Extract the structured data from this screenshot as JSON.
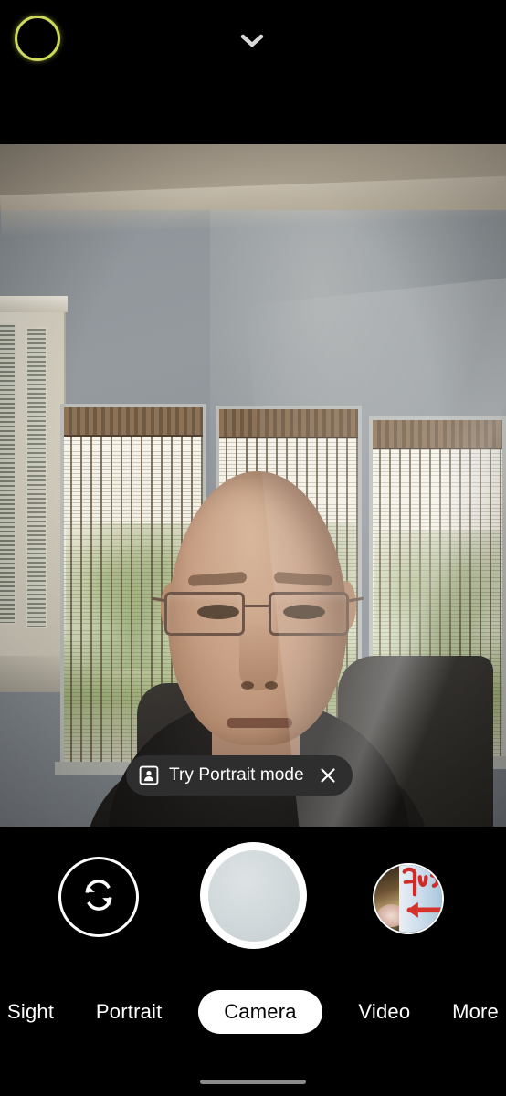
{
  "app": {
    "name": "Camera",
    "screen": "viewfinder"
  },
  "top_bar": {
    "recording_indicator_name": "camera-active-indicator",
    "recording_indicator_color": "#cdd95a",
    "expand_label": "chevron-down-icon"
  },
  "viewfinder": {
    "description": "Front-facing camera selfie preview of a bald man wearing glasses in a room with blue-gray walls and three windows with vertical blinds",
    "scene": {
      "ceiling_color": "#a79d8c",
      "wall_color": "#8e9499",
      "subject": "person",
      "windows": 3,
      "cabinet_color": "#e6e1d4",
      "shirt_color": "#1d1b1a"
    }
  },
  "suggestion": {
    "icon": "portrait-frame-icon",
    "text": "Try Portrait mode",
    "close_icon": "close-icon",
    "background_color": "#2e2e2e"
  },
  "controls": {
    "flip_camera_label": "flip-camera-icon",
    "shutter_label": "shutter-button",
    "shutter_fill_color": "#ccd4d6",
    "gallery_label": "gallery-thumbnail",
    "gallery_preview": "photo with red handwriting and a red arrow on a light blue panel"
  },
  "modes": {
    "items": [
      {
        "label": "Sight",
        "active": false,
        "truncated": true
      },
      {
        "label": "Portrait",
        "active": false,
        "truncated": false
      },
      {
        "label": "Camera",
        "active": true,
        "truncated": false
      },
      {
        "label": "Video",
        "active": false,
        "truncated": false
      },
      {
        "label": "More",
        "active": false,
        "truncated": true
      }
    ],
    "active_label": "Camera",
    "active_pill_color": "#ffffff",
    "active_text_color": "#000000"
  },
  "nav": {
    "gesture_bar": "home-gesture-bar"
  }
}
